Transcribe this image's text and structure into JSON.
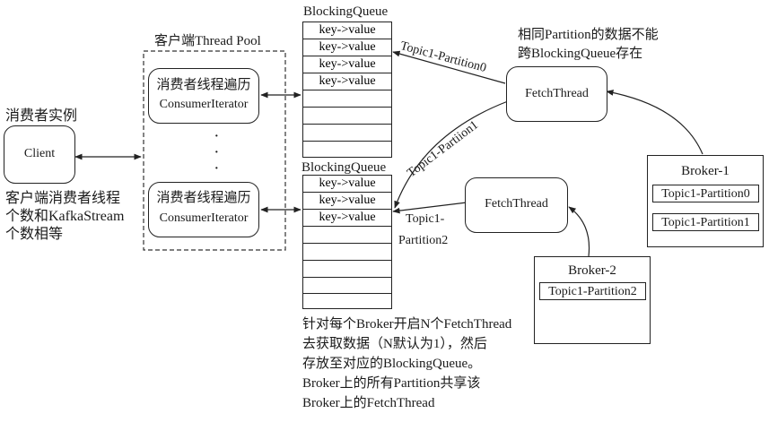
{
  "client": {
    "heading": "消费者实例",
    "label": "Client",
    "note_lines": [
      "客户端消费者线程",
      "个数和KafkaStream",
      "个数相等"
    ]
  },
  "pool": {
    "title": "客户端Thread Pool",
    "worker_top": {
      "line1": "消费者线程遍历",
      "line2": "ConsumerIterator"
    },
    "worker_bottom": {
      "line1": "消费者线程遍历",
      "line2": "ConsumerIterator"
    },
    "ellipsis": [
      "·",
      "·",
      "·"
    ]
  },
  "queue_top": {
    "title": "BlockingQueue",
    "items": [
      "key->value",
      "key->value",
      "key->value",
      "key->value"
    ]
  },
  "queue_bottom": {
    "title": "BlockingQueue",
    "items": [
      "key->value",
      "key->value",
      "key->value"
    ]
  },
  "fetch_top": {
    "label": "FetchThread"
  },
  "fetch_bottom": {
    "label": "FetchThread"
  },
  "note_top": [
    "相同Partition的数据不能",
    "跨BlockingQueue存在"
  ],
  "edges": {
    "p0": "Topic1-Partition0",
    "p1": "Topic1-Partiion1",
    "p2_line1": "Topic1-",
    "p2_line2": "Partition2"
  },
  "broker1": {
    "title": "Broker-1",
    "partitions": [
      "Topic1-Partition0",
      "Topic1-Partition1"
    ]
  },
  "broker2": {
    "title": "Broker-2",
    "partitions": [
      "Topic1-Partition2"
    ]
  },
  "bottom_note": [
    "针对每个Broker开启N个FetchThread",
    "去获取数据（N默认为1），然后",
    "存放至对应的BlockingQueue。",
    "Broker上的所有Partition共享该",
    "Broker上的FetchThread"
  ]
}
